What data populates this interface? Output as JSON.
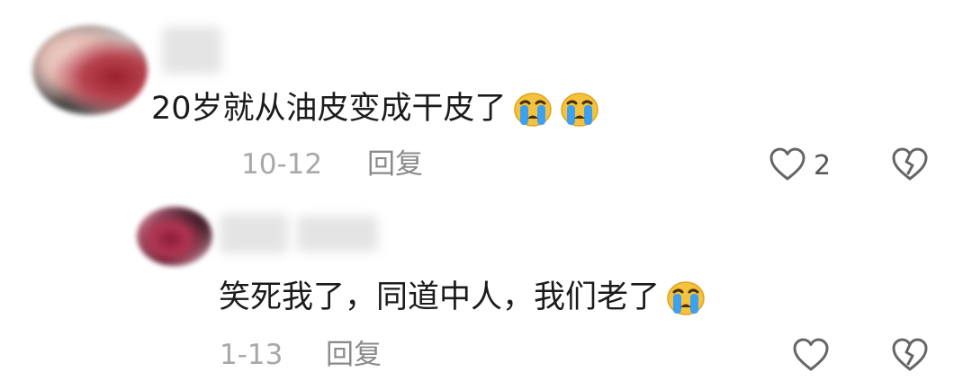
{
  "comments": [
    {
      "text": "20岁就从油皮变成干皮了",
      "emojis": [
        "crying-face-icon",
        "crying-face-icon"
      ],
      "date": "10-12",
      "reply_label": "回复",
      "like_count": "2"
    },
    {
      "text": "笑死我了，同道中人，我们老了",
      "emojis": [
        "crying-face-icon"
      ],
      "date": "1-13",
      "reply_label": "回复",
      "like_count": ""
    }
  ],
  "colors": {
    "text": "#1b1b1b",
    "meta": "#a8a8a8",
    "icon_stroke": "#666666",
    "emoji_face": "#f5c33b",
    "emoji_tear": "#3ea0f0"
  }
}
